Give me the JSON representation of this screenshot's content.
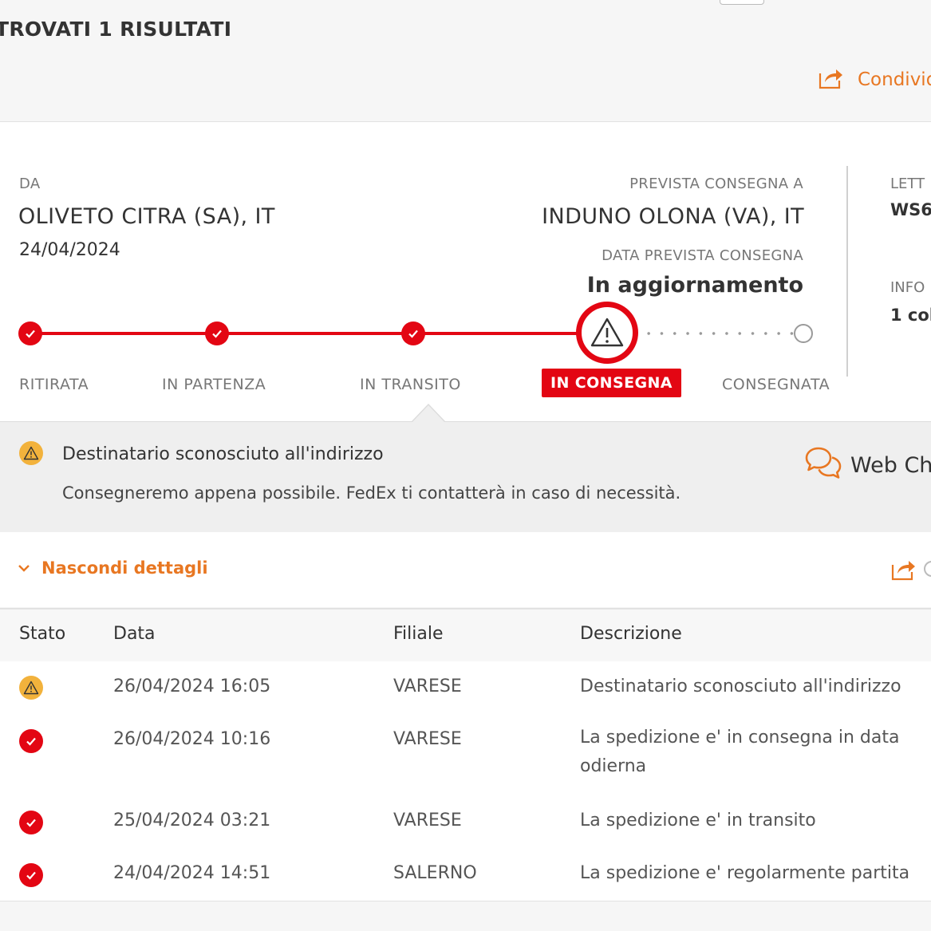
{
  "header": {
    "results_title": "TROVATI 1 RISULTATI",
    "share_label": "Condivid"
  },
  "shipment": {
    "from_label": "DA",
    "from_place": "OLIVETO CITRA (SA), IT",
    "ship_date": "24/04/2024",
    "to_label": "PREVISTA CONSEGNA A",
    "to_place": "INDUNO OLONA (VA), IT",
    "expected_label": "DATA PREVISTA CONSEGNA",
    "expected_value": "In aggiornamento",
    "side_label_1": "LETT",
    "side_value_1": "WS6",
    "side_label_2": "INFO",
    "side_value_2": "1 col"
  },
  "progress": {
    "steps": [
      {
        "label": "RITIRATA",
        "state": "done"
      },
      {
        "label": "IN PARTENZA",
        "state": "done"
      },
      {
        "label": "IN TRANSITO",
        "state": "done"
      },
      {
        "label": "IN CONSEGNA",
        "state": "warning"
      },
      {
        "label": "CONSEGNATA",
        "state": "pending"
      }
    ],
    "accent": "#e30613"
  },
  "notice": {
    "title": "Destinatario sconosciuto all'indirizzo",
    "body": "Consegneremo appena possibile. FedEx ti contatterà in caso di necessità.",
    "webchat_label": "Web Ch"
  },
  "details": {
    "toggle_label": "Nascondi dettagli"
  },
  "table": {
    "columns": [
      "Stato",
      "Data",
      "Filiale",
      "Descrizione"
    ],
    "rows": [
      {
        "status": "warning",
        "date": "26/04/2024 16:05",
        "branch": "VARESE",
        "description": "Destinatario sconosciuto all'indirizzo"
      },
      {
        "status": "done",
        "date": "26/04/2024 10:16",
        "branch": "VARESE",
        "description": "La spedizione e' in consegna in data odierna"
      },
      {
        "status": "done",
        "date": "25/04/2024 03:21",
        "branch": "VARESE",
        "description": "La spedizione e' in transito"
      },
      {
        "status": "done",
        "date": "24/04/2024 14:51",
        "branch": "SALERNO",
        "description": "La spedizione e' regolarmente partita"
      }
    ]
  },
  "colors": {
    "brand_orange": "#e87722",
    "alert_red": "#e30613",
    "warning_yellow": "#f2b23c"
  },
  "icons": [
    "share-icon",
    "check-icon",
    "warning-triangle-icon",
    "chat-bubbles-icon",
    "chevron-down-icon"
  ]
}
